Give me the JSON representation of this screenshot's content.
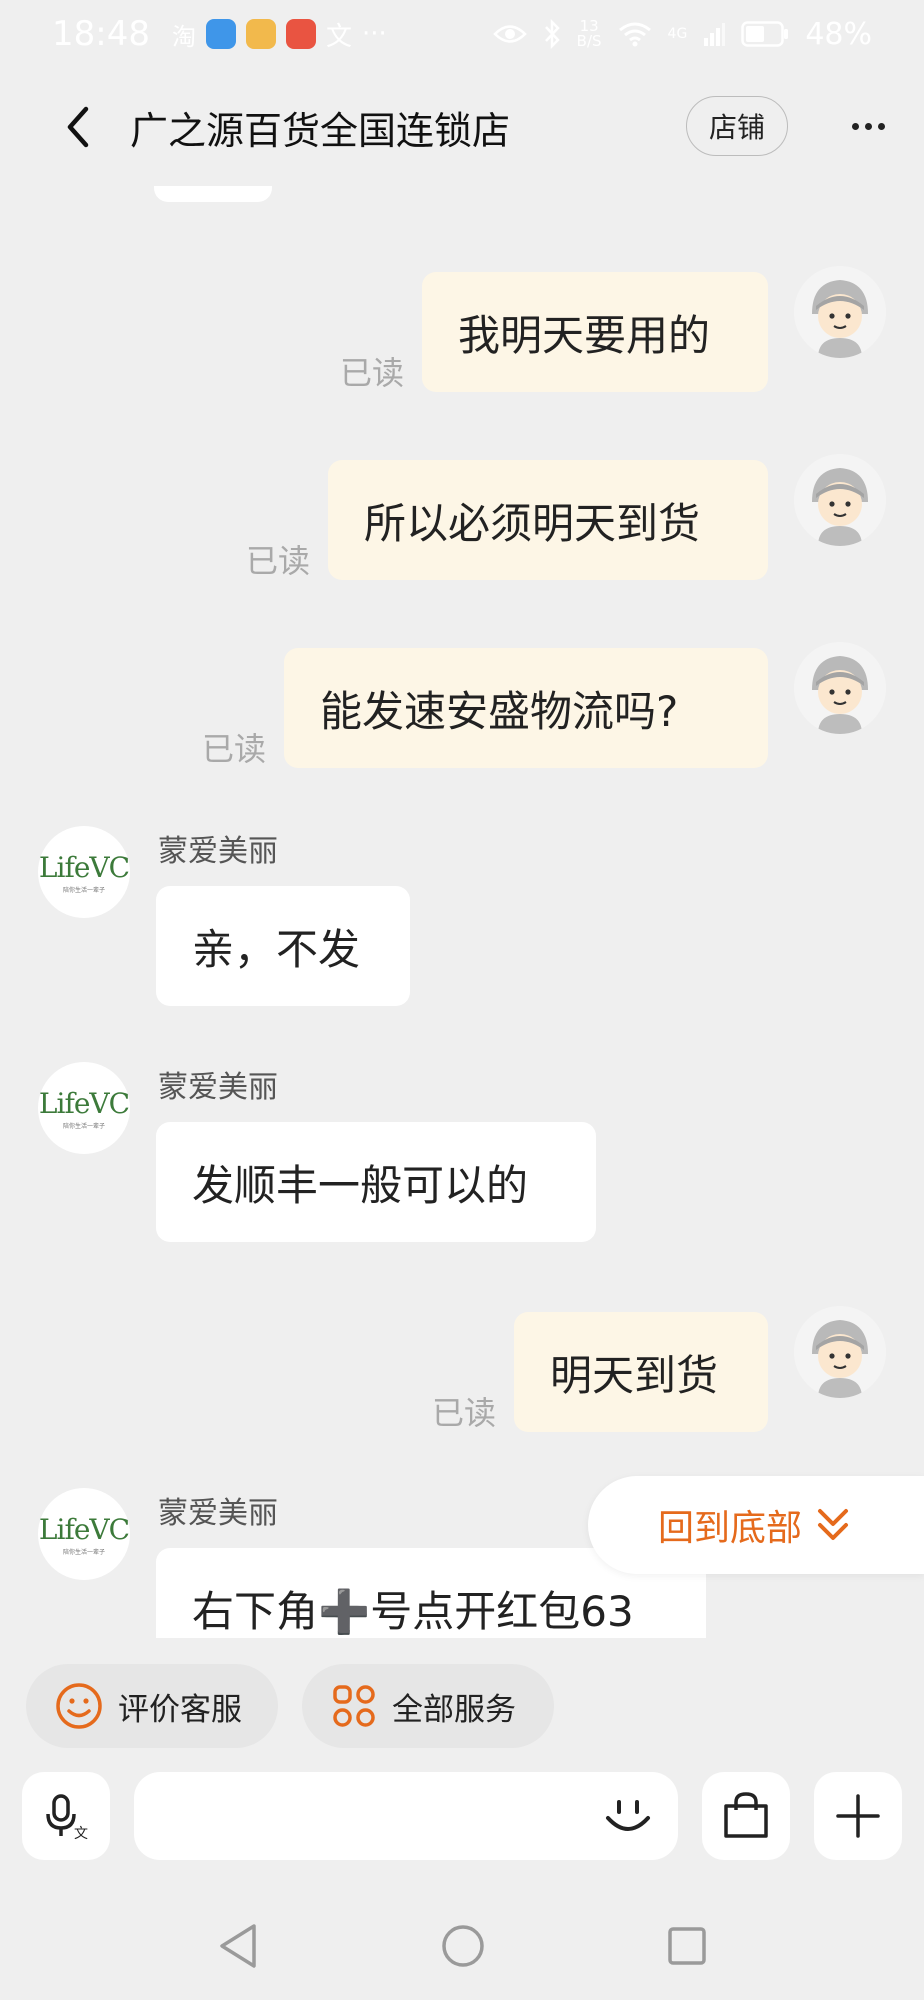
{
  "status_bar": {
    "time": "18:48",
    "net_speed_value": "13",
    "net_speed_unit": "B/S",
    "signal": "4G",
    "battery": "48%"
  },
  "header": {
    "title": "广之源百货全国连锁店",
    "shop_label": "店铺"
  },
  "messages": [
    {
      "direction": "out",
      "text": "我明天要用的",
      "read": "已读"
    },
    {
      "direction": "out",
      "text": "所以必须明天到货",
      "read": "已读"
    },
    {
      "direction": "out",
      "text": "能发速安盛物流吗?",
      "read": "已读"
    },
    {
      "direction": "in",
      "sender": "蒙爱美丽",
      "text": "亲，不发"
    },
    {
      "direction": "in",
      "sender": "蒙爱美丽",
      "text": "发顺丰一般可以的"
    },
    {
      "direction": "out",
      "text": "明天到货",
      "read": "已读"
    },
    {
      "direction": "in",
      "sender": "蒙爱美丽",
      "text": "右下角➕号点开红包63"
    }
  ],
  "shop_avatar": {
    "logo_text": "LifeVC",
    "tagline": "陪你生活一辈子"
  },
  "back_to_bottom": "回到底部",
  "quick_actions": [
    {
      "label": "评价客服",
      "icon": "smiley-icon"
    },
    {
      "label": "全部服务",
      "icon": "grid-icon"
    }
  ],
  "input": {
    "placeholder": ""
  },
  "colors": {
    "accent": "#e56a1c",
    "outgoing_bubble": "#fdf6e6",
    "incoming_bubble": "#ffffff",
    "background": "#efefef"
  }
}
